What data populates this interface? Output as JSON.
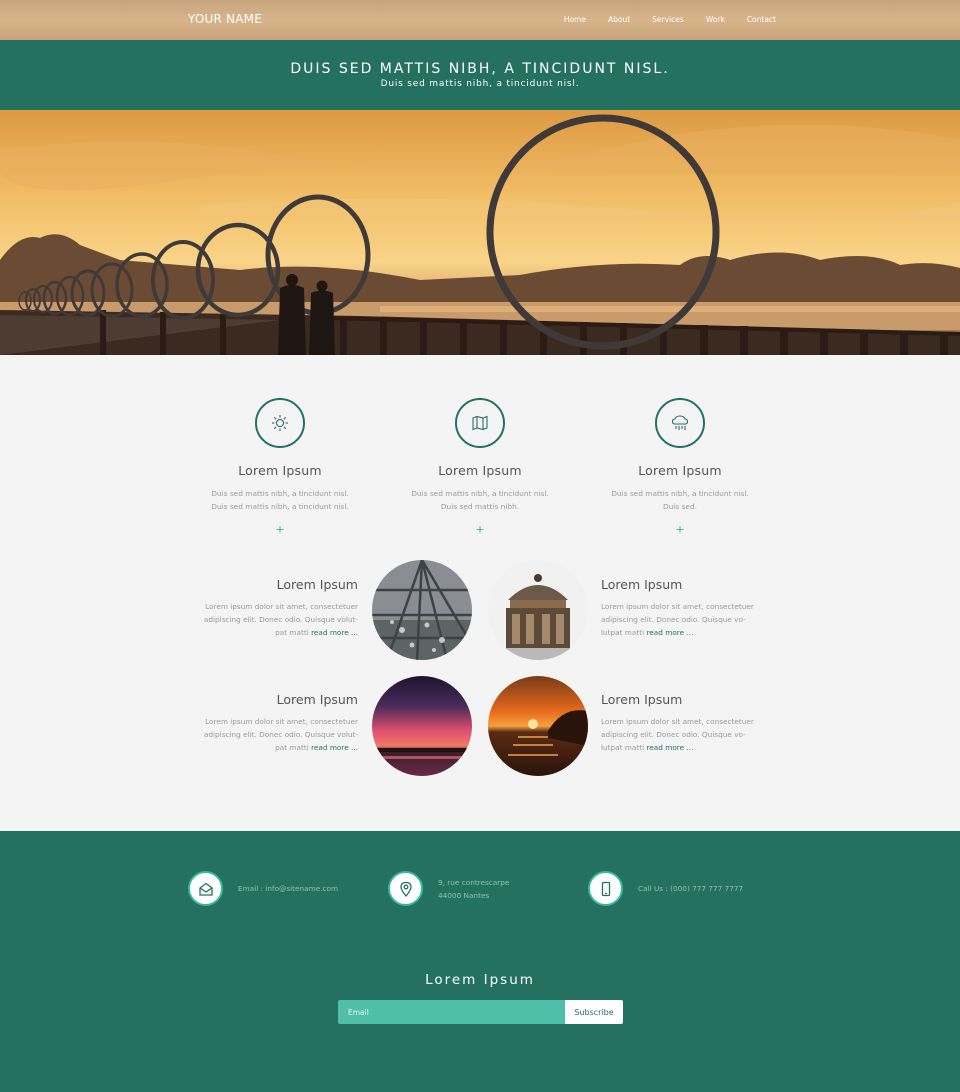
{
  "header": {
    "brand": "YOUR NAME",
    "nav": [
      "Home",
      "About",
      "Services",
      "Work",
      "Contact"
    ]
  },
  "tagline": {
    "title": "DUIS SED MATTIS NIBH, A TINCIDUNT NISL.",
    "subtitle": "Duis sed mattis nibh, a tincidunt nisl."
  },
  "features": [
    {
      "icon": "sun-icon",
      "title": "Lorem Ipsum",
      "text": "Duis sed mattis nibh, a tincidunt nisl. Duis sed mattis nibh, a tincidunt nisl.",
      "plus": "+"
    },
    {
      "icon": "map-icon",
      "title": "Lorem Ipsum",
      "text": "Duis sed mattis nibh, a tincidunt nisl. Duis sed mattis nibh.",
      "plus": "+"
    },
    {
      "icon": "rain-cloud-icon",
      "title": "Lorem Ipsum",
      "text": "Duis sed mattis nibh, a tincidunt nisl. Duis sed.",
      "plus": "+"
    }
  ],
  "works": [
    {
      "title": "Lorem Ipsum",
      "text": "Lorem ipsum dolor sit amet, consectetuer adipiscing elit. Donec odio. Quisque volut-pat matti",
      "more": "read more ..."
    },
    {
      "title": "Lorem Ipsum",
      "text": "Lorem ipsum dolor sit amet, consectetuer adipiscing elit. Donec odio. Quisque vo-lutpat matti",
      "more": "read more ..."
    },
    {
      "title": "Lorem Ipsum",
      "text": "Lorem ipsum dolor sit amet, consectetuer adipiscing elit. Donec odio. Quisque volut-pat matti",
      "more": "read more ..."
    },
    {
      "title": "Lorem Ipsum",
      "text": "Lorem ipsum dolor sit amet, consectetuer adipiscing elit. Donec odio. Quisque vo-lutpat matti",
      "more": "read more ..."
    }
  ],
  "contact": {
    "email": "Email : info@sitename.com",
    "address_line1": "9, rue contrescarpe",
    "address_line2": "44000 Nantes",
    "phone": "Call Us : (000) 777 777 7777"
  },
  "newsletter": {
    "title": "Lorem Ipsum",
    "placeholder": "Email",
    "button": "Subscribe"
  },
  "colors": {
    "primary": "#247161",
    "accent": "#3ab79c",
    "input_bg": "#4fbfa8"
  }
}
